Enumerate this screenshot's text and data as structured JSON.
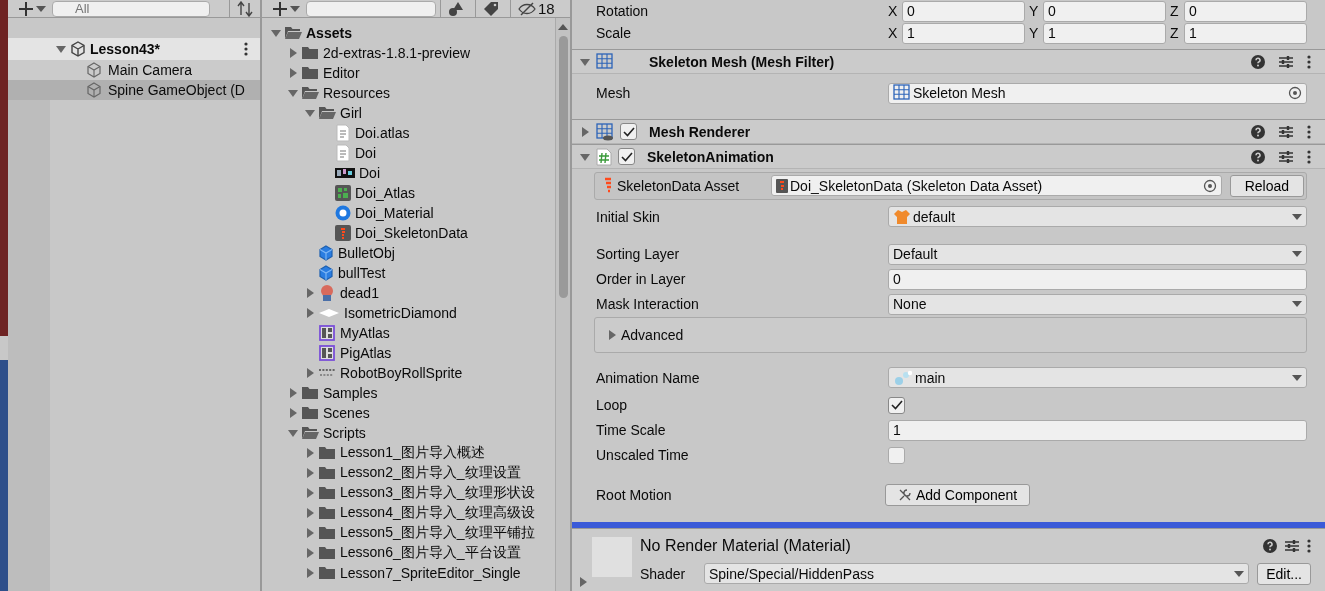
{
  "hierarchy": {
    "search": {
      "placeholder": "All"
    },
    "scene": {
      "name": "Lesson43*"
    },
    "items": [
      {
        "label": "Main Camera",
        "selected": false
      },
      {
        "label": "Spine GameObject (D",
        "selected": true
      }
    ]
  },
  "project": {
    "hidden_count": "18",
    "tree": [
      {
        "label": "Assets",
        "kind": "folder",
        "expanded": true,
        "children": [
          {
            "label": "2d-extras-1.8.1-preview",
            "kind": "folder",
            "expanded": false
          },
          {
            "label": "Editor",
            "kind": "folder",
            "expanded": false
          },
          {
            "label": "Resources",
            "kind": "folder",
            "expanded": true,
            "children": [
              {
                "label": "Girl",
                "kind": "folder",
                "expanded": true,
                "children": [
                  {
                    "label": "Doi.atlas",
                    "kind": "text"
                  },
                  {
                    "label": "Doi",
                    "kind": "text"
                  },
                  {
                    "label": "Doi",
                    "kind": "texture"
                  },
                  {
                    "label": "Doi_Atlas",
                    "kind": "atlas"
                  },
                  {
                    "label": "Doi_Material",
                    "kind": "material"
                  },
                  {
                    "label": "Doi_SkeletonData",
                    "kind": "skeleton"
                  }
                ]
              },
              {
                "label": "BulletObj",
                "kind": "prefab"
              },
              {
                "label": "bullTest",
                "kind": "prefab"
              },
              {
                "label": "dead1",
                "kind": "character",
                "expanded": false
              },
              {
                "label": "IsometricDiamond",
                "kind": "diamond",
                "expanded": false
              },
              {
                "label": "MyAtlas",
                "kind": "spriteatlas"
              },
              {
                "label": "PigAtlas",
                "kind": "spriteatlas"
              },
              {
                "label": "RobotBoyRollSprite",
                "kind": "spritesheet",
                "expanded": false
              }
            ]
          },
          {
            "label": "Samples",
            "kind": "folder",
            "expanded": false
          },
          {
            "label": "Scenes",
            "kind": "folder",
            "expanded": false
          },
          {
            "label": "Scripts",
            "kind": "folder",
            "expanded": true,
            "children": [
              {
                "label": "Lesson1_图片导入概述",
                "kind": "folder",
                "expanded": false
              },
              {
                "label": "Lesson2_图片导入_纹理设置",
                "kind": "folder",
                "expanded": false
              },
              {
                "label": "Lesson3_图片导入_纹理形状设",
                "kind": "folder",
                "expanded": false
              },
              {
                "label": "Lesson4_图片导入_纹理高级设",
                "kind": "folder",
                "expanded": false
              },
              {
                "label": "Lesson5_图片导入_纹理平铺拉",
                "kind": "folder",
                "expanded": false
              },
              {
                "label": "Lesson6_图片导入_平台设置",
                "kind": "folder",
                "expanded": false
              },
              {
                "label": "Lesson7_SpriteEditor_Single",
                "kind": "folder",
                "expanded": false
              }
            ]
          }
        ]
      }
    ]
  },
  "inspector": {
    "transform": [
      {
        "label": "Rotation",
        "fields": [
          {
            "axis": "X",
            "value": "0"
          },
          {
            "axis": "Y",
            "value": "0"
          },
          {
            "axis": "Z",
            "value": "0"
          }
        ]
      },
      {
        "label": "Scale",
        "fields": [
          {
            "axis": "X",
            "value": "1"
          },
          {
            "axis": "Y",
            "value": "1"
          },
          {
            "axis": "Z",
            "value": "1"
          }
        ]
      }
    ],
    "components": [
      {
        "kind": "meshfilter",
        "title": "Skeleton Mesh (Mesh Filter)",
        "expanded": true,
        "groups": [
          [
            {
              "kind": "object",
              "label": "Mesh",
              "value": "Skeleton Mesh"
            }
          ]
        ]
      },
      {
        "kind": "meshrenderer",
        "title": "Mesh Renderer",
        "expanded": false,
        "enabled": true
      },
      {
        "kind": "script",
        "title": "SkeletonAnimation",
        "expanded": true,
        "enabled": true,
        "groups": [
          [
            {
              "kind": "asset",
              "label": "SkeletonData Asset",
              "value": "Doi_SkeletonData (Skeleton Data Asset)",
              "button": "Reload"
            },
            {
              "kind": "skin",
              "label": "Initial Skin",
              "value": "default"
            }
          ],
          [
            {
              "kind": "dropdown",
              "label": "Sorting Layer",
              "value": "Default"
            },
            {
              "kind": "number",
              "label": "Order in Layer",
              "value": "0"
            },
            {
              "kind": "dropdown",
              "label": "Mask Interaction",
              "value": "None"
            },
            {
              "kind": "foldout",
              "label": "Advanced",
              "expanded": false
            }
          ],
          [
            {
              "kind": "animation",
              "label": "Animation Name",
              "value": "main"
            },
            {
              "kind": "checkbox",
              "label": "Loop",
              "checked": true
            },
            {
              "kind": "number",
              "label": "Time Scale",
              "value": "1"
            },
            {
              "kind": "checkbox",
              "label": "Unscaled Time",
              "checked": false
            }
          ],
          [
            {
              "kind": "button",
              "label": "Root Motion",
              "value": "Add Component"
            }
          ]
        ]
      }
    ],
    "material": {
      "title": "No Render Material (Material)",
      "shader_label": "Shader",
      "shader": "Spine/Special/HiddenPass",
      "button": "Edit...",
      "expanded": false
    }
  }
}
